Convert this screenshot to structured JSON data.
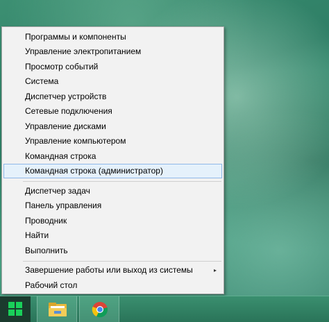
{
  "menu": {
    "items": [
      {
        "label": "Программы и компоненты"
      },
      {
        "label": "Управление электропитанием"
      },
      {
        "label": "Просмотр событий"
      },
      {
        "label": "Система"
      },
      {
        "label": "Диспетчер устройств"
      },
      {
        "label": "Сетевые подключения"
      },
      {
        "label": "Управление дисками"
      },
      {
        "label": "Управление компьютером"
      },
      {
        "label": "Командная строка"
      },
      {
        "label": "Командная строка (администратор)"
      },
      {
        "label": "Диспетчер задач"
      },
      {
        "label": "Панель управления"
      },
      {
        "label": "Проводник"
      },
      {
        "label": "Найти"
      },
      {
        "label": "Выполнить"
      },
      {
        "label": "Завершение работы или выход из системы"
      },
      {
        "label": "Рабочий стол"
      }
    ],
    "hovered_index": 9,
    "submenu_arrow": "▸"
  },
  "taskbar": {
    "start_icon": "windows-logo-icon",
    "pinned": [
      {
        "icon": "file-explorer-icon"
      },
      {
        "icon": "chrome-icon"
      }
    ],
    "colors": {
      "accent_green": "#19d05a"
    }
  }
}
